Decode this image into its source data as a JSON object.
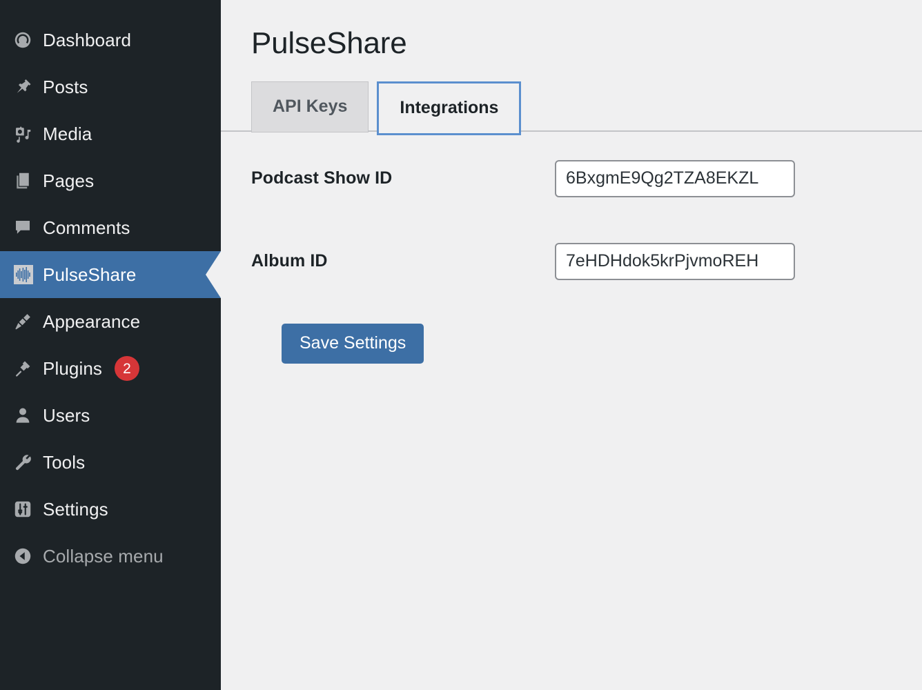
{
  "sidebar": {
    "items": [
      {
        "label": "Dashboard",
        "icon": "dashboard-gauge-icon",
        "current": false,
        "badge": null
      },
      {
        "label": "Posts",
        "icon": "pushpin-icon",
        "current": false,
        "badge": null
      },
      {
        "label": "Media",
        "icon": "camera-music-icon",
        "current": false,
        "badge": null
      },
      {
        "label": "Pages",
        "icon": "pages-stack-icon",
        "current": false,
        "badge": null
      },
      {
        "label": "Comments",
        "icon": "comment-bubble-icon",
        "current": false,
        "badge": null
      },
      {
        "label": "PulseShare",
        "icon": "waveform-icon",
        "current": true,
        "badge": null
      },
      {
        "label": "Appearance",
        "icon": "paintbrush-icon",
        "current": false,
        "badge": null
      },
      {
        "label": "Plugins",
        "icon": "plug-icon",
        "current": false,
        "badge": "2"
      },
      {
        "label": "Users",
        "icon": "user-icon",
        "current": false,
        "badge": null
      },
      {
        "label": "Tools",
        "icon": "wrench-icon",
        "current": false,
        "badge": null
      },
      {
        "label": "Settings",
        "icon": "sliders-icon",
        "current": false,
        "badge": null
      },
      {
        "label": "Collapse menu",
        "icon": "collapse-arrow-icon",
        "current": false,
        "badge": null
      }
    ]
  },
  "header": {
    "title": "PulseShare"
  },
  "tabs": [
    {
      "label": "API Keys",
      "active": false
    },
    {
      "label": "Integrations",
      "active": true
    }
  ],
  "form": {
    "fields": [
      {
        "label": "Podcast Show ID",
        "value": "6BxgmE9Qg2TZA8EKZL",
        "placeholder": ""
      },
      {
        "label": "Album ID",
        "value": "7eHDHdok5krPjvmoREH",
        "placeholder": ""
      }
    ],
    "save_label": "Save Settings"
  },
  "colors": {
    "sidebar_bg": "#1d2327",
    "accent_blue": "#3d6fa5",
    "tab_focus_blue": "#5b8fce",
    "badge_red": "#d63638",
    "content_bg": "#f0f0f1",
    "tab_inactive_bg": "#dcdcde"
  }
}
